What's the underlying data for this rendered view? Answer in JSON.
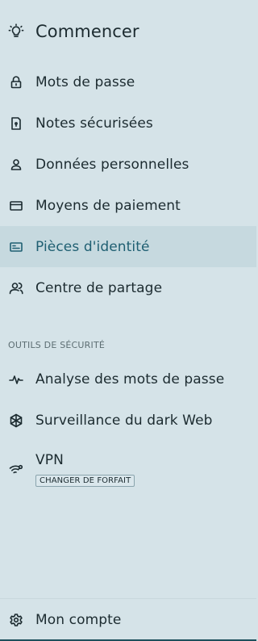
{
  "nav": {
    "top": {
      "label": "Commencer",
      "icon": "lightbulb-icon"
    },
    "items": [
      {
        "label": "Mots de passe",
        "icon": "lock-icon"
      },
      {
        "label": "Notes sécurisées",
        "icon": "note-icon"
      },
      {
        "label": "Données personnelles",
        "icon": "person-icon"
      },
      {
        "label": "Moyens de paiement",
        "icon": "card-icon"
      },
      {
        "label": "Pièces d'identité",
        "icon": "id-card-icon",
        "active": true
      },
      {
        "label": "Centre de partage",
        "icon": "sharing-icon"
      }
    ],
    "security_section": {
      "title": "OUTILS DE SÉCURITÉ",
      "items": [
        {
          "label": "Analyse des mots de passe",
          "icon": "pulse-icon"
        },
        {
          "label": "Surveillance du dark Web",
          "icon": "dark-web-icon"
        },
        {
          "label": "VPN",
          "icon": "vpn-icon",
          "badge": "CHANGER DE FORFAIT"
        }
      ]
    },
    "footer": {
      "label": "Mon compte",
      "icon": "gear-icon"
    }
  },
  "colors": {
    "background": "#d5e3e8",
    "active_background": "#c6d9df",
    "active_text": "#1f5f72",
    "text": "#1c2b30"
  }
}
